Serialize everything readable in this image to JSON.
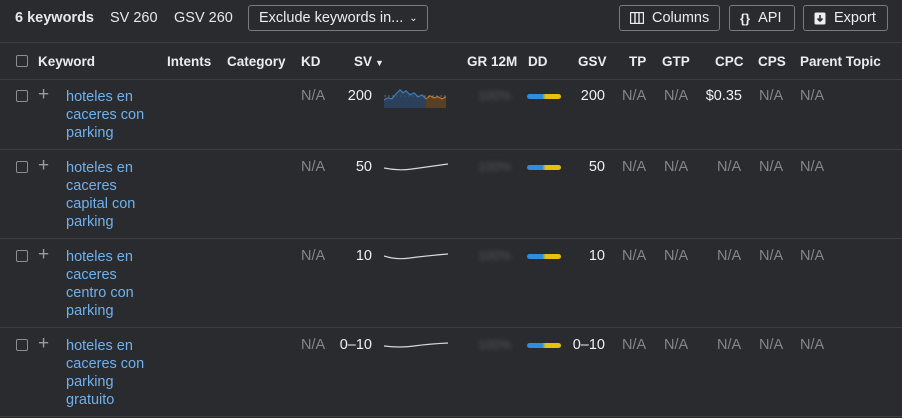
{
  "toolbar": {
    "keyword_count": "6 keywords",
    "sv": "SV 260",
    "gsv": "GSV 260",
    "exclude_label": "Exclude keywords in...",
    "columns_label": "Columns",
    "api_label": "API",
    "export_label": "Export"
  },
  "columns": {
    "keyword": "Keyword",
    "intents": "Intents",
    "category": "Category",
    "kd": "KD",
    "sv": "SV",
    "gr12m": "GR 12M",
    "dd": "DD",
    "gsv": "GSV",
    "tp": "TP",
    "gtp": "GTP",
    "cpc": "CPC",
    "cps": "CPS",
    "parent_topic": "Parent Topic"
  },
  "rows": [
    {
      "keyword": "hoteles en caceres con parking",
      "kd": "N/A",
      "sv": "200",
      "gr12m": "100%",
      "gsv": "200",
      "tp": "N/A",
      "gtp": "N/A",
      "cpc": "$0.35",
      "cps": "N/A",
      "parent_topic": "N/A"
    },
    {
      "keyword": "hoteles en caceres capital con parking",
      "kd": "N/A",
      "sv": "50",
      "gr12m": "100%",
      "gsv": "50",
      "tp": "N/A",
      "gtp": "N/A",
      "cpc": "N/A",
      "cps": "N/A",
      "parent_topic": "N/A"
    },
    {
      "keyword": "hoteles en caceres centro con parking",
      "kd": "N/A",
      "sv": "10",
      "gr12m": "100%",
      "gsv": "10",
      "tp": "N/A",
      "gtp": "N/A",
      "cpc": "N/A",
      "cps": "N/A",
      "parent_topic": "N/A"
    },
    {
      "keyword": "hoteles en caceres con parking gratuito",
      "kd": "N/A",
      "sv": "0–10",
      "gr12m": "100%",
      "gsv": "0–10",
      "tp": "N/A",
      "gtp": "N/A",
      "cpc": "N/A",
      "cps": "N/A",
      "parent_topic": "N/A"
    }
  ],
  "colors": {
    "link": "#6fb1ee",
    "dd_blue": "#2f8de0",
    "dd_yellow": "#e7c20c",
    "trend_blue": "#4a90d9",
    "trend_orange": "#d9872f"
  },
  "icons": [
    "columns-icon",
    "braces-icon",
    "download-icon",
    "chevron-down-icon",
    "plus-icon",
    "sort-down-icon"
  ]
}
